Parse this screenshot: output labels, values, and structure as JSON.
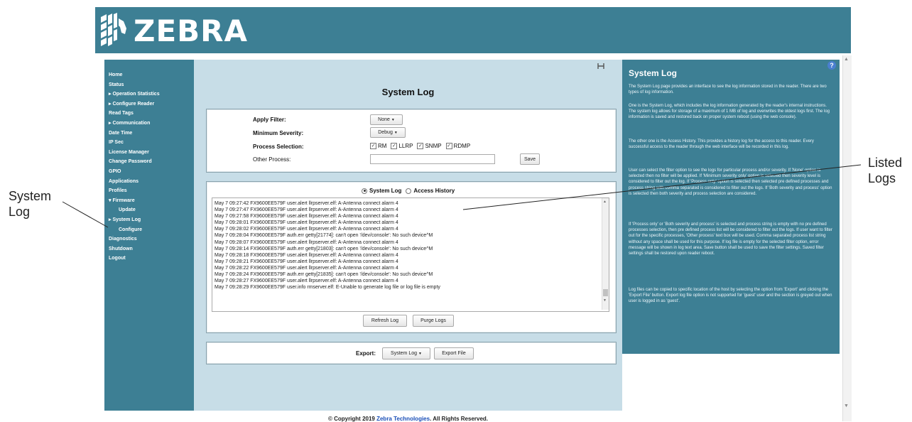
{
  "brand": {
    "logo_text": "ZEBRA"
  },
  "sidebar": {
    "items": [
      {
        "label": "Home",
        "sub": false
      },
      {
        "label": "Status",
        "sub": false
      },
      {
        "label": "▸ Operation Statistics",
        "sub": false
      },
      {
        "label": "▸ Configure Reader",
        "sub": false
      },
      {
        "label": "Read Tags",
        "sub": false
      },
      {
        "label": "▸ Communication",
        "sub": false
      },
      {
        "label": "Date Time",
        "sub": false
      },
      {
        "label": "IP Sec",
        "sub": false
      },
      {
        "label": "License Manager",
        "sub": false
      },
      {
        "label": "Change Password",
        "sub": false
      },
      {
        "label": "GPIO",
        "sub": false
      },
      {
        "label": "Applications",
        "sub": false
      },
      {
        "label": "Profiles",
        "sub": false
      },
      {
        "label": "▾ Firmware",
        "sub": false
      },
      {
        "label": "Update",
        "sub": true
      },
      {
        "label": "▸ System Log",
        "sub": false
      },
      {
        "label": "Configure",
        "sub": true
      },
      {
        "label": "Diagnostics",
        "sub": false
      },
      {
        "label": "Shutdown",
        "sub": false
      },
      {
        "label": "Logout",
        "sub": false
      }
    ]
  },
  "main": {
    "title": "System Log",
    "filter": {
      "apply_filter_label": "Apply Filter:",
      "apply_filter_value": "None",
      "min_severity_label": "Minimum Severity:",
      "min_severity_value": "Debug",
      "process_selection_label": "Process Selection:",
      "processes": [
        "RM",
        "LLRP",
        "SNMP",
        "RDMP"
      ],
      "other_process_label": "Other Process:",
      "other_process_value": "",
      "save_label": "Save"
    },
    "log_tabs": {
      "system_log": "System Log",
      "access_history": "Access History",
      "selected": "system_log"
    },
    "log_lines": [
      "May  7 09:27:42 FX9600EE579F user.alert llrpserver.elf: A-Antenna connect alarm 4",
      "May  7 09:27:47 FX9600EE579F user.alert llrpserver.elf: A-Antenna connect alarm 4",
      "May  7 09:27:58 FX9600EE579F user.alert llrpserver.elf: A-Antenna connect alarm 4",
      "May  7 09:28:01 FX9600EE579F user.alert llrpserver.elf: A-Antenna connect alarm 4",
      "May  7 09:28:02 FX9600EE579F user.alert llrpserver.elf: A-Antenna connect alarm 4",
      "May  7 09:28:04 FX9600EE579F auth.err getty[21774]: can't open '/dev/console': No such device^M",
      "May  7 09:28:07 FX9600EE579F user.alert llrpserver.elf: A-Antenna connect alarm 4",
      "May  7 09:28:14 FX9600EE579F auth.err getty[21803]: can't open '/dev/console': No such device^M",
      "May  7 09:28:18 FX9600EE579F user.alert llrpserver.elf: A-Antenna connect alarm 4",
      "May  7 09:28:21 FX9600EE579F user.alert llrpserver.elf: A-Antenna connect alarm 4",
      "May  7 09:28:22 FX9600EE579F user.alert llrpserver.elf: A-Antenna connect alarm 4",
      "May  7 09:28:24 FX9600EE579F auth.err getty[21835]: can't open '/dev/console': No such device^M",
      "May  7 09:28:27 FX9600EE579F user.alert llrpserver.elf: A-Antenna connect alarm 4",
      "May  7 09:28:29 FX9600EE579F user.info rmserver.elf: E-Unable to generate log file or log file is empty"
    ],
    "refresh_label": "Refresh Log",
    "purge_label": "Purge Logs",
    "export_label": "Export:",
    "export_select_value": "System Log",
    "export_file_label": "Export File"
  },
  "help": {
    "title": "System Log",
    "icon": "?",
    "paragraphs": [
      "The System Log page provides an interface to see the log information stored in the reader. There are two types of log information.",
      "One is the System Log, which includes the log information generated by the reader's internal instructions. The system log allows for storage of a maximum of 1 MB of log and overwrites the oldest logs first. The log information is saved and restored back on proper system reboot (using the web console).",
      "The other one is the Access History. This provides a history log for the access to this reader. Every successful access to the reader through the web interface will be recorded in this log.",
      "User can select the filter option to see the logs for particular process and/or severity. If 'None' option is selected then no filter will be applied. If 'Minimum severity only' option is selected then severity level is considered to filter out the log. If 'Process only' option is selected then selected pre defined processes and process string with comma separated is considered to filter out the logs. If 'Both severity and process' option is selected then both severity and process selection are considered.",
      "If 'Process only' or 'Both severity and process' is selected and process string is empty with no pre defined processes selection, then pre defined process list will be considered to filter out the logs. If user want to filter out for the specific processes, 'Other process' text box will be used. Comma separated process list string without any space shall be used for this purpose. If log file is empty for the selected filter option, error message will be shown in log text area. Save button shall be used to save the filter settings. Saved filter settings shall be restored upon reader reboot.",
      "Log files can be copied to specific location of the host by selecting the option from 'Export' and clicking the 'Export File' button. Export log file option is not supported for 'guest' user and the section is greyed out when user is logged in as 'guest'."
    ]
  },
  "footer": {
    "prefix": "© Copyright 2019 ",
    "link": "Zebra Technologies",
    "suffix": ". All Rights Reserved."
  },
  "callouts": {
    "system_log": "System\nLog",
    "listed_logs": "Listed\nLogs"
  },
  "colors": {
    "brand": "#3d7f94",
    "panel": "#c7dde7"
  }
}
